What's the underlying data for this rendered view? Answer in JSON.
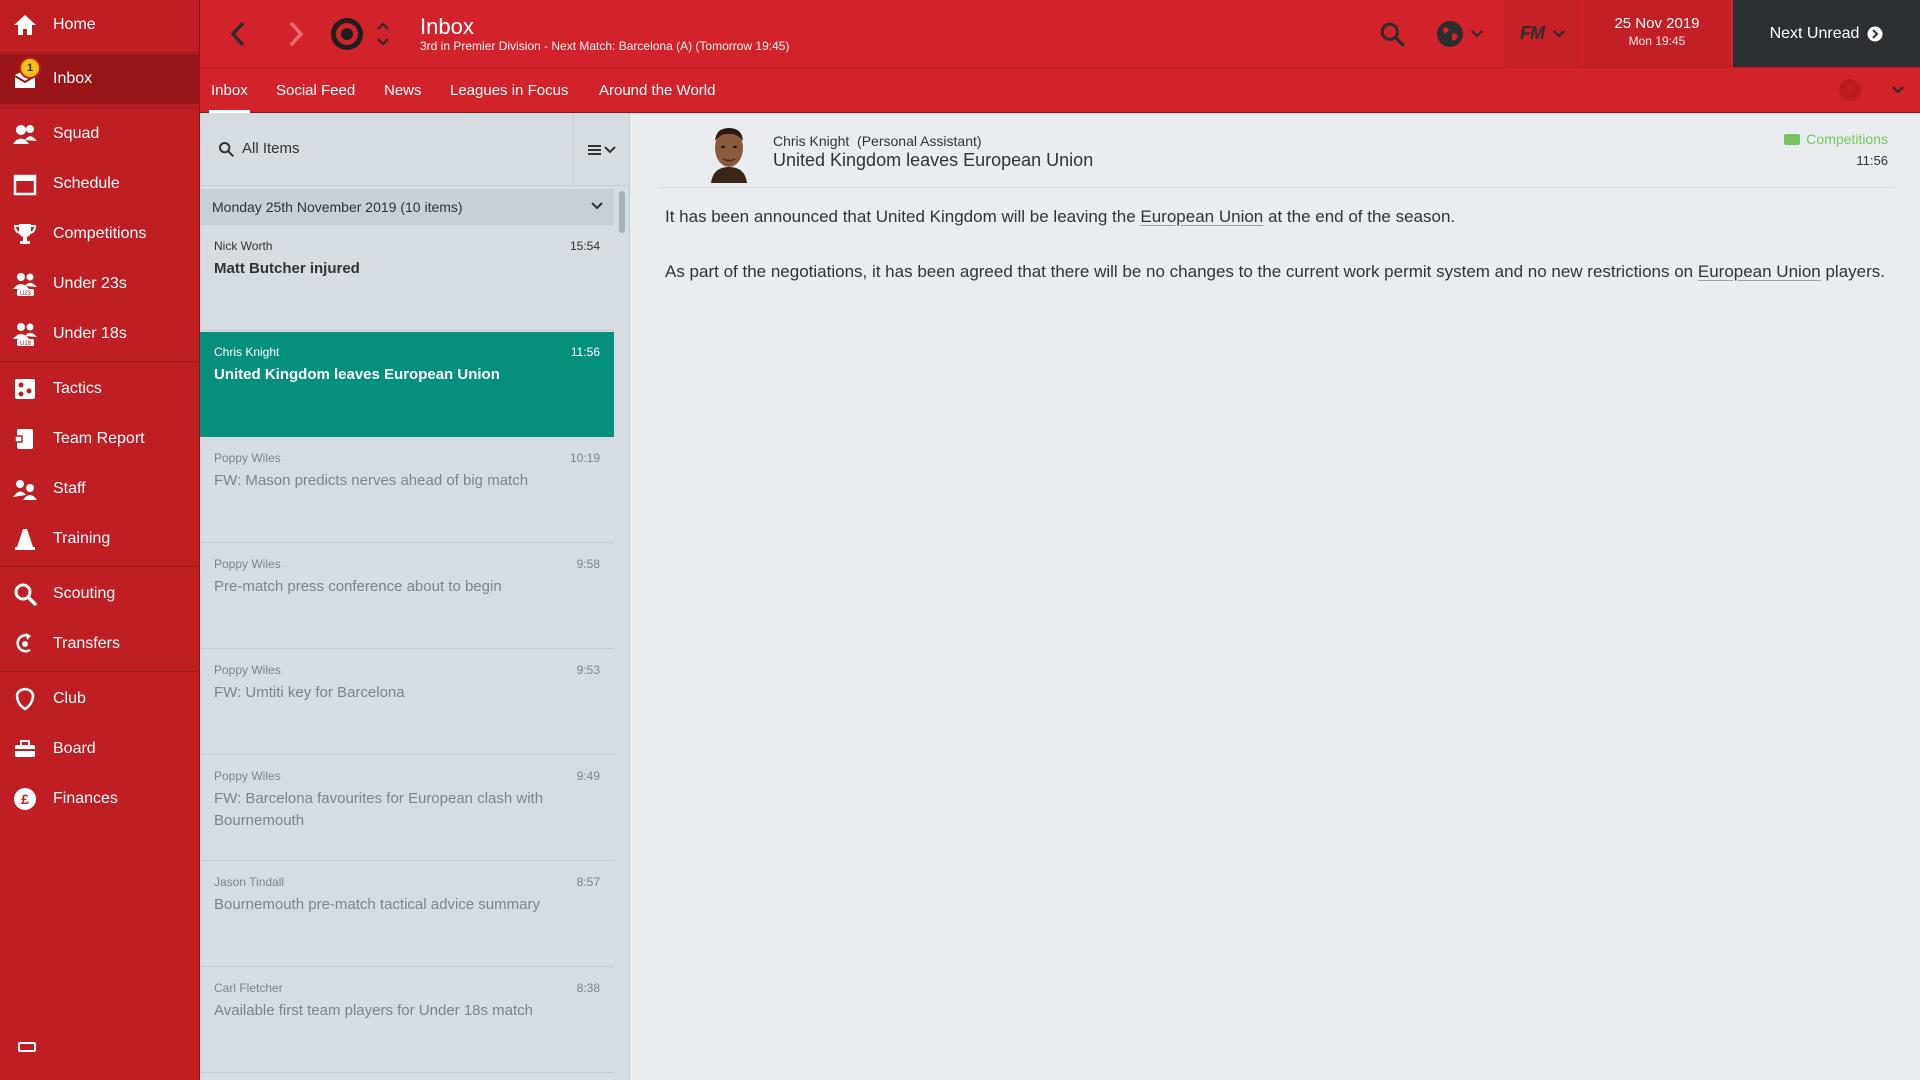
{
  "sidebar": {
    "items": [
      {
        "id": "home",
        "label": "Home",
        "icon": "home-icon"
      },
      {
        "id": "inbox",
        "label": "Inbox",
        "icon": "inbox-icon",
        "badge": "1",
        "active": true
      },
      {
        "id": "squad",
        "label": "Squad",
        "icon": "squad-icon"
      },
      {
        "id": "schedule",
        "label": "Schedule",
        "icon": "calendar-icon"
      },
      {
        "id": "competitions",
        "label": "Competitions",
        "icon": "trophy-icon"
      },
      {
        "id": "under23s",
        "label": "Under 23s",
        "icon": "u23-icon"
      },
      {
        "id": "under18s",
        "label": "Under 18s",
        "icon": "u18-icon"
      },
      {
        "id": "tactics",
        "label": "Tactics",
        "icon": "tactics-icon"
      },
      {
        "id": "team-report",
        "label": "Team Report",
        "icon": "report-icon"
      },
      {
        "id": "staff",
        "label": "Staff",
        "icon": "staff-icon"
      },
      {
        "id": "training",
        "label": "Training",
        "icon": "cone-icon"
      },
      {
        "id": "scouting",
        "label": "Scouting",
        "icon": "search-icon"
      },
      {
        "id": "transfers",
        "label": "Transfers",
        "icon": "transfers-icon"
      },
      {
        "id": "club",
        "label": "Club",
        "icon": "shield-icon"
      },
      {
        "id": "board",
        "label": "Board",
        "icon": "board-icon"
      },
      {
        "id": "finances",
        "label": "Finances",
        "icon": "pound-icon"
      }
    ]
  },
  "header": {
    "title": "Inbox",
    "subtitle": "3rd in Premier Division - Next Match: Barcelona (A) (Tomorrow 19:45)",
    "date": "25 Nov 2019",
    "time": "Mon 19:45",
    "next_unread": "Next Unread",
    "fm_label": "FM"
  },
  "tabs": [
    {
      "label": "Inbox",
      "active": true
    },
    {
      "label": "Social Feed"
    },
    {
      "label": "News"
    },
    {
      "label": "Leagues in Focus"
    },
    {
      "label": "Around the World"
    }
  ],
  "list": {
    "filter_label": "All Items",
    "group_header": "Monday 25th November 2019 (10 items)",
    "messages": [
      {
        "sender": "Nick Worth",
        "time": "15:54",
        "subject": "Matt Butcher injured",
        "state": "unread"
      },
      {
        "sender": "Chris Knight",
        "time": "11:56",
        "subject": "United Kingdom leaves European Union",
        "state": "selected"
      },
      {
        "sender": "Poppy Wiles",
        "time": "10:19",
        "subject": "FW: Mason predicts nerves ahead of big match",
        "state": "read"
      },
      {
        "sender": "Poppy Wiles",
        "time": "9:58",
        "subject": "Pre-match press conference about to begin",
        "state": "read"
      },
      {
        "sender": "Poppy Wiles",
        "time": "9:53",
        "subject": "FW: Umtiti key for Barcelona",
        "state": "read"
      },
      {
        "sender": "Poppy Wiles",
        "time": "9:49",
        "subject": "FW: Barcelona favourites for European clash with Bournemouth",
        "state": "read"
      },
      {
        "sender": "Jason Tindall",
        "time": "8:57",
        "subject": "Bournemouth pre-match tactical advice summary",
        "state": "read"
      },
      {
        "sender": "Carl Fletcher",
        "time": "8:38",
        "subject": "Available first team players for Under 18s match",
        "state": "read"
      }
    ]
  },
  "reader": {
    "sender": "Chris Knight",
    "role": "(Personal Assistant)",
    "subject": "United Kingdom leaves European Union",
    "tag": "Competitions",
    "time": "11:56",
    "p1_a": "It has been announced that United Kingdom will be leaving the ",
    "p1_link": "European Union",
    "p1_b": " at the end of the season.",
    "p2_a": "As part of the negotiations, it has been agreed that there will be no changes to the current work permit system and no new restrictions on ",
    "p2_link": "European Union",
    "p2_b": " players."
  },
  "colors": {
    "sidebar": "#bf1e22",
    "topbar": "#d3232a",
    "selected_row": "#05907c",
    "tag": "#78c463",
    "next_unread_bg": "#2d3033"
  }
}
